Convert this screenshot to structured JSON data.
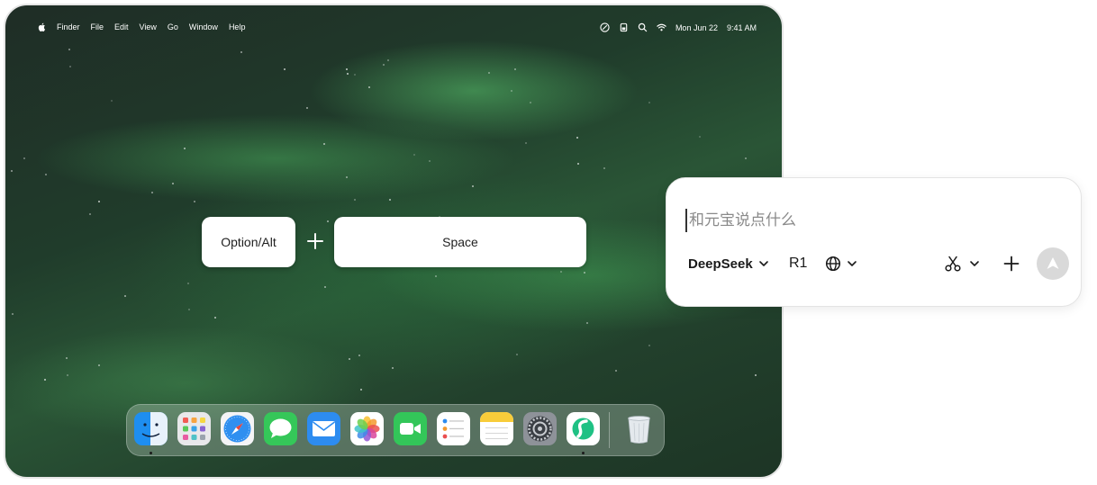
{
  "menubar": {
    "apple_icon": "apple-logo-icon",
    "items": [
      "Finder",
      "File",
      "Edit",
      "View",
      "Go",
      "Window",
      "Help"
    ],
    "status_icons": [
      "user-circle-icon",
      "battery-icon",
      "search-icon",
      "wifi-icon"
    ],
    "date": "Mon Jun 22",
    "time": "9:41 AM"
  },
  "shortcut": {
    "modifier_key": "Option/Alt",
    "key": "Space"
  },
  "dock": {
    "apps": [
      {
        "name": "finder",
        "icon": "finder-icon",
        "running": true
      },
      {
        "name": "launchpad",
        "icon": "launchpad-icon",
        "running": false
      },
      {
        "name": "safari",
        "icon": "safari-icon",
        "running": false
      },
      {
        "name": "messages",
        "icon": "messages-icon",
        "running": false
      },
      {
        "name": "mail",
        "icon": "mail-icon",
        "running": false
      },
      {
        "name": "photos",
        "icon": "photos-icon",
        "running": false
      },
      {
        "name": "facetime",
        "icon": "facetime-icon",
        "running": false
      },
      {
        "name": "reminders",
        "icon": "reminders-icon",
        "running": false
      },
      {
        "name": "notes",
        "icon": "notes-icon",
        "running": false
      },
      {
        "name": "system-settings",
        "icon": "gear-icon",
        "running": false
      },
      {
        "name": "yuanbao",
        "icon": "yuanbao-icon",
        "running": true
      }
    ],
    "trash_icon": "trash-icon"
  },
  "chat": {
    "placeholder": "和元宝说点什么",
    "value": "",
    "model": "DeepSeek",
    "mode": "R1",
    "web_icon": "globe-icon",
    "cut_icon": "scissors-icon",
    "add_icon": "plus-icon",
    "send_icon": "send-arrow-icon"
  },
  "colors": {
    "send_button_disabled": "#d9d9d9",
    "panel_bg": "#ffffff",
    "wallpaper_green": "#2a5536"
  }
}
